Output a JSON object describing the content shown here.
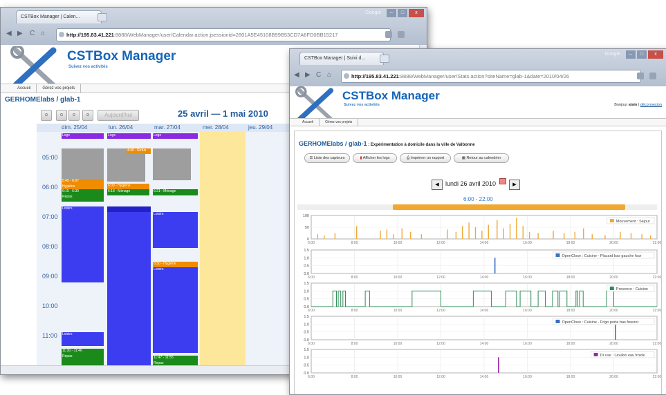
{
  "win1": {
    "tab_title": "CSTBox Manager | Calen...",
    "window_label": "Google",
    "url_host": "http://195.83.41.221",
    "url_rest": ":8888/WebManager/user/Calendar.action;jsessionid=2801A5E45108B99B53CD7A6FD0BB15217",
    "app_title": "CSTBox Manager",
    "app_subtitle": "Suivez vos activités",
    "menu": [
      "Accueil",
      "Gérez vos projets"
    ],
    "breadcrumb": "GERHOMElabs / glab-1",
    "today_label": "Aujourd'hui",
    "date_range": "25 avril — 1 mai 2010",
    "days": [
      "dim. 25/04",
      "lun. 26/04",
      "mar. 27/04",
      "mer. 28/04",
      "jeu. 29/04"
    ],
    "hours": [
      "05:00",
      "06:00",
      "07:00",
      "08:00",
      "09:00",
      "10:00",
      "11:00"
    ],
    "events": {
      "loge": "Loge",
      "hygiene": "Hygiène",
      "repas": "Repas",
      "loisirs": "Loisirs",
      "fan_tag": "4:40 - Refus",
      "hyg_time_d0": "5:45 - 6:07",
      "hyg_time_d1": "6:00 - Hygiène",
      "repas_time_d0": "6:15 - 6:30",
      "repas_time_d1": "6:18 - Ménage",
      "repas_time_d2": "6:21 - Ménage",
      "hyg_time_d2": "8:30 - Hygiène",
      "repas_late_d0": "11:30 - 11:46",
      "repas_late_d2": "11:47 - 11:55"
    }
  },
  "win2": {
    "tab_title": "CSTBox Manager | Suivi d...",
    "window_label": "Google",
    "url_host": "http://195.83.41.221",
    "url_rest": ":8888/WebManager/user/Stats.action?siteName=glab-1&date=2010/04/26",
    "app_title": "CSTBox Manager",
    "app_subtitle": "Suivez vos activités",
    "greeting_prefix": "Bonjour",
    "greeting_user": "alain",
    "logout": "déconnexion",
    "menu": [
      "Accueil",
      "Gérez vos projets"
    ],
    "breadcrumb": "GERHOMElabs / glab-1",
    "breadcrumb_desc": " : Expérimentation à domicile dans la ville de Valbonne",
    "buttons": [
      "Liste des capteurs",
      "Afficher les logs",
      "Imprimer un rapport",
      "Retour au calendrier"
    ],
    "date_label": "lundi 26 avril 2010",
    "range_label": "6:00 - 22:00",
    "x_ticks": [
      "6:00",
      "8:00",
      "10:00",
      "12:00",
      "14:00",
      "16:00",
      "18:00",
      "20:00",
      "22:00"
    ],
    "legends": [
      "Mouvement : Séjour",
      "OpenClose : Cuisine - Placard bas gauche four",
      "Presence : Cuisine",
      "OpenClose : Cuisine - Frigo porte bas freezer",
      "Dr use : Lavabo eau froide"
    ],
    "colors": {
      "orange": "#f0a830",
      "blue": "#3b6fc4",
      "green": "#2e8b57",
      "purple": "#9b2aa6"
    }
  },
  "chart_data": [
    {
      "type": "bar",
      "title": "",
      "series": [
        {
          "name": "Mouvement : Séjour"
        }
      ],
      "xlabel": "",
      "ylabel": "",
      "x_range": [
        "6:00",
        "22:00"
      ],
      "ylim": [
        0,
        100
      ],
      "y_ticks": [
        0,
        50,
        100
      ]
    },
    {
      "type": "bar",
      "series": [
        {
          "name": "OpenClose : Cuisine - Placard bas gauche four"
        }
      ],
      "x_range": [
        "6:00",
        "22:00"
      ],
      "ylim": [
        0,
        1.5
      ],
      "y_ticks": [
        0,
        0.5,
        1.0,
        1.5
      ],
      "events": [
        {
          "x": "14:30",
          "y": 1
        }
      ]
    },
    {
      "type": "line",
      "series": [
        {
          "name": "Presence : Cuisine"
        }
      ],
      "x_range": [
        "6:00",
        "22:00"
      ],
      "ylim": [
        0,
        1.5
      ],
      "y_ticks": [
        0,
        0.5,
        1.0,
        1.5
      ],
      "on_intervals": [
        [
          "7:00",
          "7:10"
        ],
        [
          "7:15",
          "7:22"
        ],
        [
          "7:28",
          "7:35"
        ],
        [
          "8:30",
          "8:42"
        ],
        [
          "10:40",
          "12:00"
        ],
        [
          "13:30",
          "14:20"
        ],
        [
          "15:00",
          "15:30"
        ],
        [
          "15:40",
          "16:10"
        ],
        [
          "16:30",
          "16:50"
        ],
        [
          "17:10",
          "17:25"
        ],
        [
          "17:30",
          "17:50"
        ],
        [
          "18:15",
          "18:20"
        ],
        [
          "18:25",
          "18:35"
        ],
        [
          "19:40",
          "20:00"
        ]
      ]
    },
    {
      "type": "bar",
      "series": [
        {
          "name": "OpenClose : Cuisine - Frigo porte bas freezer"
        }
      ],
      "x_range": [
        "6:00",
        "22:00"
      ],
      "ylim": [
        0,
        1.5
      ],
      "y_ticks": [
        0,
        0.5,
        1.0,
        1.5
      ],
      "events": [
        {
          "x": "20:05",
          "y": 1
        }
      ]
    },
    {
      "type": "bar",
      "series": [
        {
          "name": "Dr use : Lavabo eau froide"
        }
      ],
      "x_range": [
        "6:00",
        "22:00"
      ],
      "ylim": [
        0,
        1.5
      ],
      "y_ticks": [
        0,
        0.5,
        1.0,
        1.5
      ],
      "events": [
        {
          "x": "14:40",
          "y": 1
        }
      ]
    }
  ]
}
